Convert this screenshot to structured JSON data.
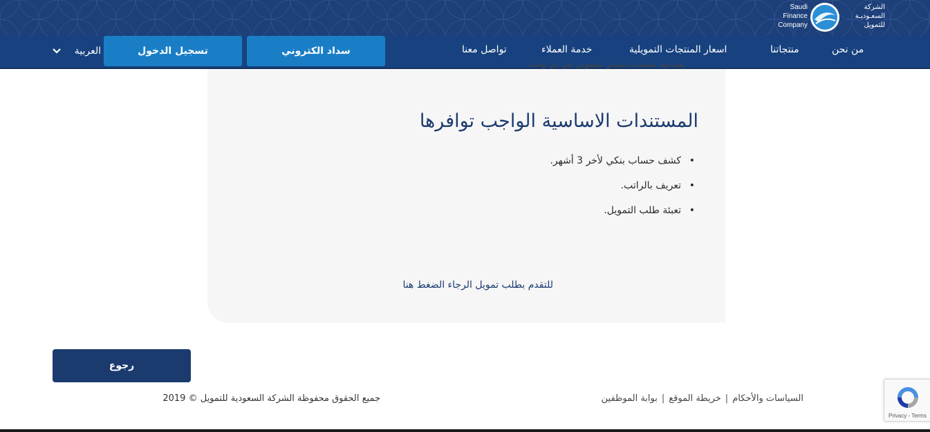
{
  "logo": {
    "english_lines": [
      "Saudi",
      "Finance",
      "Company"
    ],
    "arabic_lines": [
      "الشركة",
      "السعـوديـة",
      "للتمويل"
    ]
  },
  "nav": {
    "items": [
      "من نحن",
      "منتجاتنا",
      "اسعار المنتجات التمويلية",
      "خدمة العملاء",
      "تواصل معنا"
    ],
    "epay_label": "سداد الكتروني",
    "login_label": "تسجيل الدخول",
    "language": "العربية"
  },
  "content": {
    "cut_off_text": "إمكانية السداد المبكر للتمويل في أي وقت.",
    "section_title": "المستندات الاساسية الواجب توافرها",
    "documents": [
      "كشف حساب بنكي لأخر 3 أشهر.",
      "تعريف بالراتب.",
      "تعبئة طلب التمويل."
    ],
    "apply_link": "للتقدم بطلب تمويل الرجاء الضغط هنا"
  },
  "back_label": "رجوع",
  "footer": {
    "links": [
      "السياسات والأحكام",
      "خريطة الموقع",
      "بوابة الموظفين"
    ],
    "separator": "|",
    "copyright": "جميع الحقوق محفوظة الشركة السعودية للتمويل © 2019"
  },
  "recaptcha": {
    "text": "Privacy - Terms"
  },
  "colors": {
    "header": "#1d3f7a",
    "nav_band": "#17427f",
    "accent_button": "#1a7ec7",
    "primary_dark": "#1b3b6f",
    "card_bg": "#f6f6f6"
  }
}
